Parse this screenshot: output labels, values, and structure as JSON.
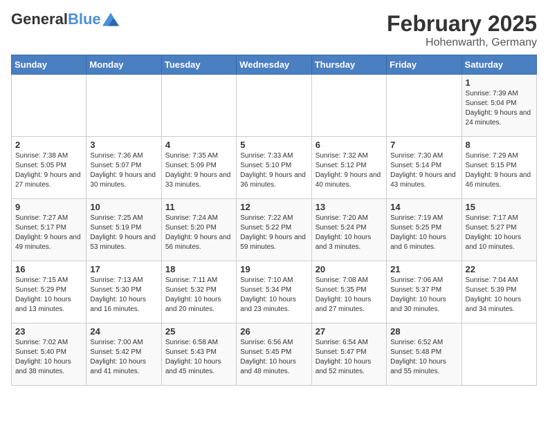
{
  "header": {
    "logo_line1": "General",
    "logo_line2": "Blue",
    "month_title": "February 2025",
    "location": "Hohenwarth, Germany"
  },
  "weekdays": [
    "Sunday",
    "Monday",
    "Tuesday",
    "Wednesday",
    "Thursday",
    "Friday",
    "Saturday"
  ],
  "weeks": [
    [
      {
        "day": "",
        "info": ""
      },
      {
        "day": "",
        "info": ""
      },
      {
        "day": "",
        "info": ""
      },
      {
        "day": "",
        "info": ""
      },
      {
        "day": "",
        "info": ""
      },
      {
        "day": "",
        "info": ""
      },
      {
        "day": "1",
        "info": "Sunrise: 7:39 AM\nSunset: 5:04 PM\nDaylight: 9 hours and 24 minutes."
      }
    ],
    [
      {
        "day": "2",
        "info": "Sunrise: 7:38 AM\nSunset: 5:05 PM\nDaylight: 9 hours and 27 minutes."
      },
      {
        "day": "3",
        "info": "Sunrise: 7:36 AM\nSunset: 5:07 PM\nDaylight: 9 hours and 30 minutes."
      },
      {
        "day": "4",
        "info": "Sunrise: 7:35 AM\nSunset: 5:09 PM\nDaylight: 9 hours and 33 minutes."
      },
      {
        "day": "5",
        "info": "Sunrise: 7:33 AM\nSunset: 5:10 PM\nDaylight: 9 hours and 36 minutes."
      },
      {
        "day": "6",
        "info": "Sunrise: 7:32 AM\nSunset: 5:12 PM\nDaylight: 9 hours and 40 minutes."
      },
      {
        "day": "7",
        "info": "Sunrise: 7:30 AM\nSunset: 5:14 PM\nDaylight: 9 hours and 43 minutes."
      },
      {
        "day": "8",
        "info": "Sunrise: 7:29 AM\nSunset: 5:15 PM\nDaylight: 9 hours and 46 minutes."
      }
    ],
    [
      {
        "day": "9",
        "info": "Sunrise: 7:27 AM\nSunset: 5:17 PM\nDaylight: 9 hours and 49 minutes."
      },
      {
        "day": "10",
        "info": "Sunrise: 7:25 AM\nSunset: 5:19 PM\nDaylight: 9 hours and 53 minutes."
      },
      {
        "day": "11",
        "info": "Sunrise: 7:24 AM\nSunset: 5:20 PM\nDaylight: 9 hours and 56 minutes."
      },
      {
        "day": "12",
        "info": "Sunrise: 7:22 AM\nSunset: 5:22 PM\nDaylight: 9 hours and 59 minutes."
      },
      {
        "day": "13",
        "info": "Sunrise: 7:20 AM\nSunset: 5:24 PM\nDaylight: 10 hours and 3 minutes."
      },
      {
        "day": "14",
        "info": "Sunrise: 7:19 AM\nSunset: 5:25 PM\nDaylight: 10 hours and 6 minutes."
      },
      {
        "day": "15",
        "info": "Sunrise: 7:17 AM\nSunset: 5:27 PM\nDaylight: 10 hours and 10 minutes."
      }
    ],
    [
      {
        "day": "16",
        "info": "Sunrise: 7:15 AM\nSunset: 5:29 PM\nDaylight: 10 hours and 13 minutes."
      },
      {
        "day": "17",
        "info": "Sunrise: 7:13 AM\nSunset: 5:30 PM\nDaylight: 10 hours and 16 minutes."
      },
      {
        "day": "18",
        "info": "Sunrise: 7:11 AM\nSunset: 5:32 PM\nDaylight: 10 hours and 20 minutes."
      },
      {
        "day": "19",
        "info": "Sunrise: 7:10 AM\nSunset: 5:34 PM\nDaylight: 10 hours and 23 minutes."
      },
      {
        "day": "20",
        "info": "Sunrise: 7:08 AM\nSunset: 5:35 PM\nDaylight: 10 hours and 27 minutes."
      },
      {
        "day": "21",
        "info": "Sunrise: 7:06 AM\nSunset: 5:37 PM\nDaylight: 10 hours and 30 minutes."
      },
      {
        "day": "22",
        "info": "Sunrise: 7:04 AM\nSunset: 5:39 PM\nDaylight: 10 hours and 34 minutes."
      }
    ],
    [
      {
        "day": "23",
        "info": "Sunrise: 7:02 AM\nSunset: 5:40 PM\nDaylight: 10 hours and 38 minutes."
      },
      {
        "day": "24",
        "info": "Sunrise: 7:00 AM\nSunset: 5:42 PM\nDaylight: 10 hours and 41 minutes."
      },
      {
        "day": "25",
        "info": "Sunrise: 6:58 AM\nSunset: 5:43 PM\nDaylight: 10 hours and 45 minutes."
      },
      {
        "day": "26",
        "info": "Sunrise: 6:56 AM\nSunset: 5:45 PM\nDaylight: 10 hours and 48 minutes."
      },
      {
        "day": "27",
        "info": "Sunrise: 6:54 AM\nSunset: 5:47 PM\nDaylight: 10 hours and 52 minutes."
      },
      {
        "day": "28",
        "info": "Sunrise: 6:52 AM\nSunset: 5:48 PM\nDaylight: 10 hours and 55 minutes."
      },
      {
        "day": "",
        "info": ""
      }
    ]
  ]
}
